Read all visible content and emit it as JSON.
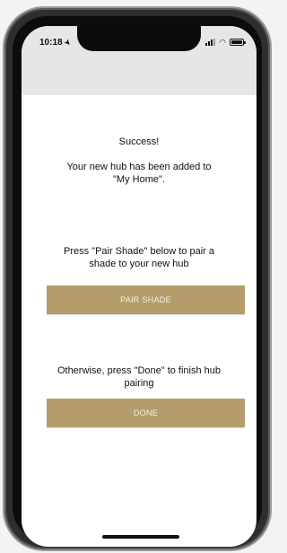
{
  "status_bar": {
    "time": "10:18",
    "location_icon": "location-arrow-icon",
    "signal_icon": "cellular-signal-icon",
    "wifi_icon": "wifi-icon",
    "battery_icon": "battery-icon",
    "battery_level": 1.0
  },
  "content": {
    "title": "Success!",
    "message": "Your new hub has been added to \"My Home\".",
    "pair_instruction": "Press \"Pair Shade\" below to pair a shade to your new hub",
    "pair_button_label": "PAIR SHADE",
    "done_instruction": "Otherwise, press \"Done\" to finish hub pairing",
    "done_button_label": "DONE"
  },
  "colors": {
    "button_bg": "#b49d6b",
    "button_text": "#f6f1e6",
    "header_bg": "#e6e6e6",
    "screen_bg": "#ffffff"
  }
}
